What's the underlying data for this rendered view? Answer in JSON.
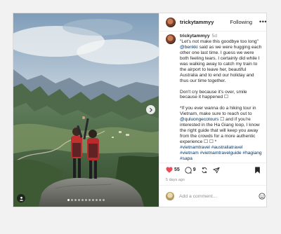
{
  "post": {
    "username": "trickytammyy",
    "follow_label": "Following",
    "more_label": "•••",
    "caption": {
      "username": "trickytammyy",
      "time": "5d",
      "p1_a": "\"Let's not make this goodbye too long\"",
      "p1_mention": "@benkki",
      "p1_b": "said as we were hugging each other one last time. I guess we were both feeling tears. I certainly did while I was walking away to catch my train to the airport to leave her, beautiful Australia and to end our holiday and thus our time together.",
      "p2": "Don't cry because it's over, smile because it happened ☐",
      "p3_a": "*If you ever wanna do a hiking tour in Vietnam, make sure to reach out to",
      "p3_mention": "@quluongecotours",
      "p3_b": "☐ and if you're interested in the Ha Giang loop, I know the right guide that will keep you away from the crowds for a more authentic experience ☐ ☐ *",
      "hashtags_1": "#vietnamtravel #australiatravel",
      "hashtags_2": "#vietnam #vietnamtravelguide #hagiang #sapa"
    },
    "likes_count": "55",
    "comments_count": "9",
    "date": "5 days ago",
    "comment_placeholder": "Add a comment..."
  },
  "colors": {
    "like_red": "#ed4956",
    "link_blue": "#00376b",
    "muted_gray": "#8e8e8e"
  },
  "icons": [
    "heart-icon",
    "comment-icon",
    "repost-icon",
    "share-icon",
    "bookmark-icon",
    "emoji-icon",
    "more-icon",
    "chevron-right-icon",
    "user-tag-icon"
  ],
  "carousel": {
    "total": 11,
    "active": 1
  }
}
